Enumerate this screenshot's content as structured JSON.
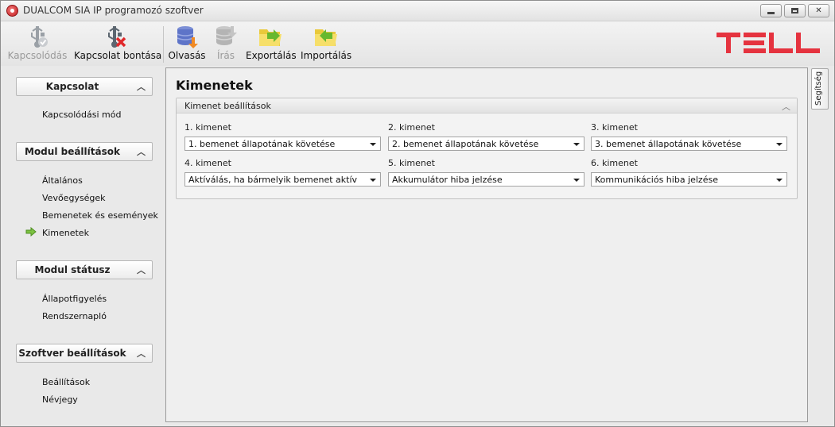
{
  "window": {
    "title": "DUALCOM SIA IP programozó szoftver"
  },
  "toolbar": {
    "connect_label": "Kapcsolódás",
    "disconnect_label": "Kapcsolat bontása",
    "read_label": "Olvasás",
    "write_label": "Írás",
    "export_label": "Exportálás",
    "import_label": "Importálás",
    "logo_text": "TELL",
    "logo_color": "#e5333f"
  },
  "sidebar": {
    "groups": [
      {
        "title": "Kapcsolat",
        "items": [
          "Kapcsolódási mód"
        ]
      },
      {
        "title": "Modul beállítások",
        "items": [
          "Általános",
          "Vevőegységek",
          "Bemenetek és események",
          "Kimenetek"
        ]
      },
      {
        "title": "Modul státusz",
        "items": [
          "Állapotfigyelés",
          "Rendszernapló"
        ]
      },
      {
        "title": "Szoftver beállítások",
        "items": [
          "Beállítások",
          "Névjegy"
        ]
      }
    ],
    "active_item": "Kimenetek"
  },
  "help_tab": {
    "label": "Segítség"
  },
  "main": {
    "title": "Kimenetek",
    "groupbox_title": "Kimenet beállítások",
    "outputs": [
      {
        "label": "1. kimenet",
        "value": "1. bemenet állapotának követése"
      },
      {
        "label": "2. kimenet",
        "value": "2. bemenet állapotának követése"
      },
      {
        "label": "3. kimenet",
        "value": "3. bemenet állapotának követése"
      },
      {
        "label": "4. kimenet",
        "value": "Aktíválás, ha bármelyik bemenet aktív"
      },
      {
        "label": "5. kimenet",
        "value": "Akkumulátor hiba jelzése"
      },
      {
        "label": "6. kimenet",
        "value": "Kommunikációs hiba jelzése"
      }
    ]
  }
}
